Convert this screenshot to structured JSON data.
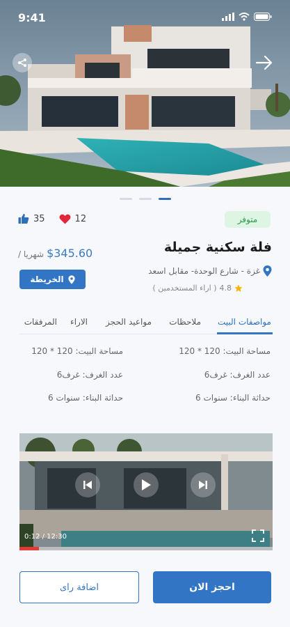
{
  "status_bar": {
    "time": "9:41"
  },
  "gallery": {
    "slide_count": 3,
    "active_slide": 2
  },
  "property": {
    "status": "متوفر",
    "likes": "35",
    "favorites": "12",
    "title": "فلة سكنية جميلة",
    "price": "$345.60",
    "price_period": "/ شهريا",
    "address": "غزة - شارع الوحدة- مقابل اسعد",
    "rating": "4.8",
    "rating_label": "( اراء المستخدمين )",
    "map_label": "الخريطة"
  },
  "tabs": [
    "مواصفات البيت",
    "ملاحظات",
    "مواعيد الحجز",
    "الاراء",
    "المرفقات"
  ],
  "specs": {
    "right": [
      {
        "text": "مساحة البيت:  120 * 120"
      },
      {
        "text": "عدد الغرف:  غرف6"
      },
      {
        "text": "حداثة البناء:  سنوات 6"
      }
    ],
    "left": [
      {
        "text": "مساحة البيت:  120 * 120"
      },
      {
        "text": "عدد الغرف:  غرف6"
      },
      {
        "text": "حداثة البناء:  سنوات 6"
      }
    ]
  },
  "video": {
    "time": "0:12 / 12:30",
    "progress": 0.076
  },
  "actions": {
    "book": "احجز الان",
    "review": "اضافة راى"
  },
  "colors": {
    "primary": "#3275c4",
    "available_bg": "#dff5e4",
    "available_text": "#2b9a4a",
    "like": "#2f6fb8",
    "heart": "#e0283a",
    "star": "#f5b400",
    "progress": "#e53935"
  },
  "icons": [
    "share-icon",
    "arrow-right-icon",
    "thumbs-up-icon",
    "heart-icon",
    "location-pin-icon",
    "star-icon",
    "skip-back-icon",
    "play-icon",
    "skip-forward-icon",
    "fullscreen-icon"
  ]
}
